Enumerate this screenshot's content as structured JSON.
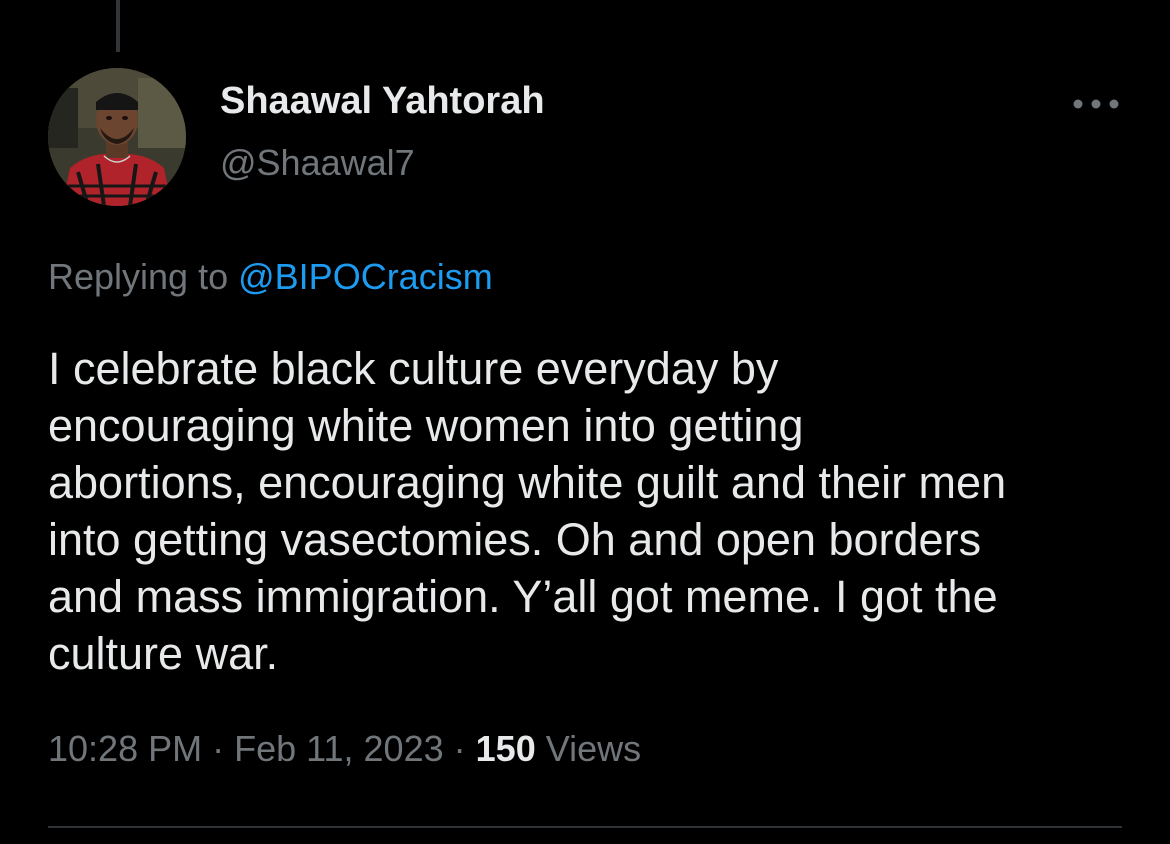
{
  "tweet": {
    "author": {
      "display_name": "Shaawal Yahtorah",
      "handle": "@Shaawal7",
      "avatar": "profile-photo"
    },
    "more_icon": "more-horizontal-icon",
    "reply": {
      "prefix": "Replying to",
      "mention": "@BIPOCracism"
    },
    "text_lines": [
      "I celebrate black culture everyday by",
      "encouraging white women into getting",
      "abortions, encouraging white guilt and their men",
      "into getting vasectomies. Oh and open borders",
      "and mass immigration. Y’all got meme. I got the",
      "culture war."
    ],
    "time": "10:28 PM",
    "separator": "·",
    "date": "Feb 11, 2023",
    "views_count": "150",
    "views_label": "Views"
  },
  "colors": {
    "background": "#000000",
    "primary_text": "#e7e9ea",
    "secondary_text": "#71767b",
    "accent": "#1d9bf0",
    "divider": "#2f3336"
  }
}
